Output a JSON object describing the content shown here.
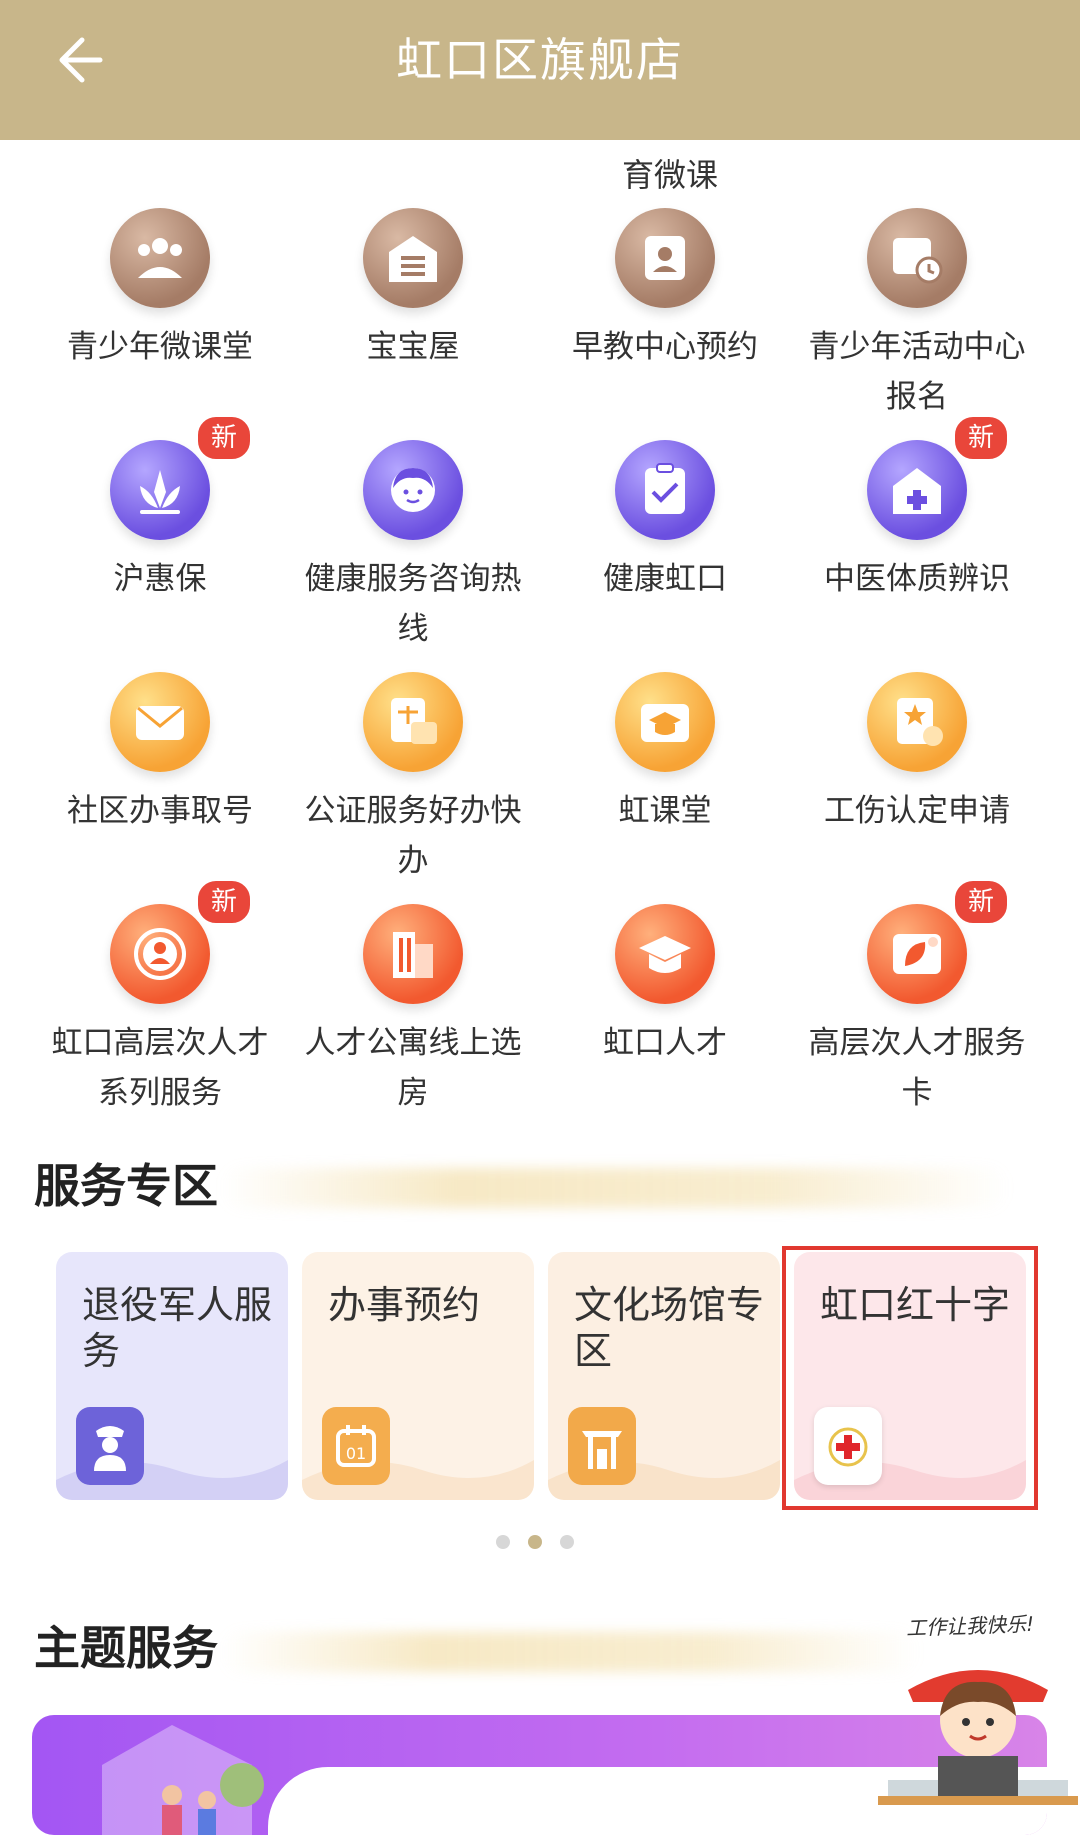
{
  "header": {
    "title": "虹口区旗舰店",
    "back_label": "返回"
  },
  "partial_item_label": "育微课",
  "grid": [
    {
      "label": "青少年微课堂",
      "color": "brown",
      "icon": "people-icon",
      "badge": ""
    },
    {
      "label": "宝宝屋",
      "color": "brown",
      "icon": "house-icon",
      "badge": ""
    },
    {
      "label": "早教中心预约",
      "color": "brown",
      "icon": "portrait-icon",
      "badge": ""
    },
    {
      "label": "青少年活动中心报名",
      "color": "brown",
      "icon": "calendar-clock-icon",
      "badge": ""
    },
    {
      "label": "沪惠保",
      "color": "purple",
      "icon": "lotus-icon",
      "badge": "新"
    },
    {
      "label": "健康服务咨询热线",
      "color": "purple",
      "icon": "face-icon",
      "badge": ""
    },
    {
      "label": "健康虹口",
      "color": "purple",
      "icon": "clipboard-check-icon",
      "badge": ""
    },
    {
      "label": "中医体质辨识",
      "color": "purple",
      "icon": "medical-house-icon",
      "badge": "新"
    },
    {
      "label": "社区办事取号",
      "color": "yellow",
      "icon": "envelope-icon",
      "badge": ""
    },
    {
      "label": "公证服务好办快办",
      "color": "yellow",
      "icon": "scale-doc-icon",
      "badge": ""
    },
    {
      "label": "虹课堂",
      "color": "yellow",
      "icon": "graduation-cap-icon",
      "badge": ""
    },
    {
      "label": "工伤认定申请",
      "color": "yellow",
      "icon": "document-star-icon",
      "badge": ""
    },
    {
      "label": "虹口高层次人才系列服务",
      "color": "orange",
      "icon": "user-ring-icon",
      "badge": "新"
    },
    {
      "label": "人才公寓线上选房",
      "color": "orange",
      "icon": "building-icon",
      "badge": ""
    },
    {
      "label": "虹口人才",
      "color": "orange",
      "icon": "mortarboard-icon",
      "badge": ""
    },
    {
      "label": "高层次人才服务卡",
      "color": "orange",
      "icon": "leaf-card-icon",
      "badge": "新"
    }
  ],
  "service_zone": {
    "title": "服务专区",
    "cards": [
      {
        "label": "退役军人服务",
        "bg": "#e7e6fb",
        "icon_bg": "#6d63d9",
        "icon": "soldier-icon"
      },
      {
        "label": "办事预约",
        "bg": "#fdf2e6",
        "icon_bg": "#f4ad4e",
        "icon": "calendar-icon"
      },
      {
        "label": "文化场馆专区",
        "bg": "#fcefe2",
        "icon_bg": "#f2a94a",
        "icon": "archway-icon"
      },
      {
        "label": "虹口红十字",
        "bg": "#fde7ea",
        "icon_bg": "#ffffff",
        "icon": "red-cross-icon"
      }
    ]
  },
  "theme_section": {
    "title": "主题服务"
  },
  "mascot": {
    "text": "工作让我快乐!"
  },
  "colors": {
    "header": "#c8b68a",
    "highlight": "#e1382f",
    "badge": "#e9463a"
  }
}
